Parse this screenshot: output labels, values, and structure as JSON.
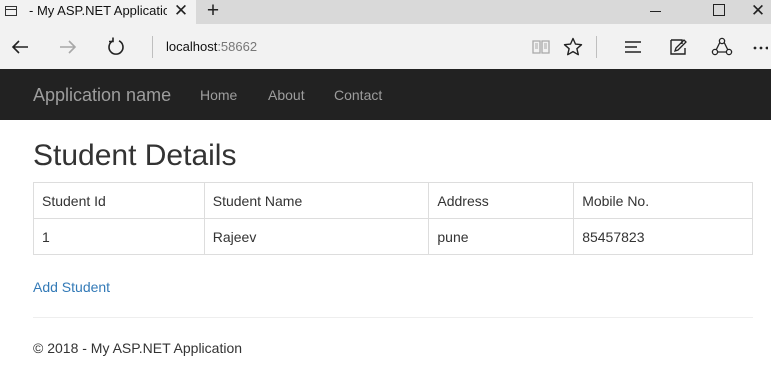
{
  "browser": {
    "tab_title": "- My ASP.NET Applicatio",
    "tab_close": "✕",
    "new_tab": "+",
    "window_close": "✕",
    "address_host": "localhost",
    "address_port": ":58662",
    "icons": [
      "page-icon",
      "back-arrow-icon",
      "forward-arrow-icon",
      "refresh-icon",
      "reading-view-icon",
      "favorite-star-icon",
      "hub-icon",
      "web-note-icon",
      "share-icon",
      "more-icon"
    ]
  },
  "site_nav": {
    "brand": "Application name",
    "links": [
      "Home",
      "About",
      "Contact"
    ],
    "background": "#222222",
    "link_color": "#9d9d9d"
  },
  "main": {
    "title": "Student Details",
    "table": {
      "headers": [
        "Student Id",
        "Student Name",
        "Address",
        "Mobile No."
      ],
      "rows": [
        [
          "1",
          "Rajeev",
          "pune",
          "85457823"
        ]
      ]
    },
    "add_link": "Add Student",
    "link_color": "#337ab7"
  },
  "footer": {
    "text": "© 2018 - My ASP.NET Application"
  }
}
